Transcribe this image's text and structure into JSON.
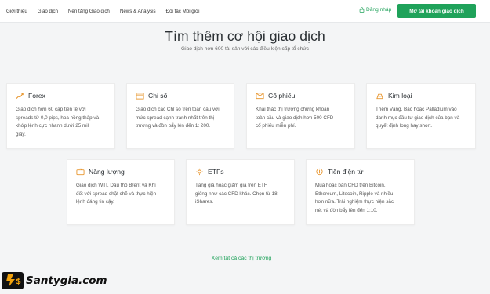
{
  "nav": {
    "items": [
      "Giới thiệu",
      "Giao dịch",
      "Nền tảng Giao dịch",
      "News & Analysis",
      "Đối tác Môi giới"
    ],
    "login_label": "Đăng nhập",
    "open_account_label": "Mở tài khoản giao dịch"
  },
  "hero": {
    "title": "Tìm thêm cơ hội giao dịch",
    "subtitle": "Giao dịch hơn 600 tài sản với các điều kiện cấp tổ chức"
  },
  "cards": [
    {
      "icon": "forex-chart-icon",
      "title": "Forex",
      "desc": [
        "Giao dịch hơn 60 cặp tiền tệ với",
        "spreads từ 0,0 pips, hoa hồng thấp và",
        "khớp lệnh cực nhanh dưới 25 mili",
        "giây."
      ]
    },
    {
      "icon": "indices-calendar-icon",
      "title": "Chỉ số",
      "desc": [
        "Giao dịch các Chỉ số trên toàn cầu với",
        "mức spread cạnh tranh nhất trên thị",
        "trường và đòn bẩy lên đến 1: 200."
      ]
    },
    {
      "icon": "shares-envelope-icon",
      "title": "Cổ phiếu",
      "desc": [
        "Khai thác thị trường chứng khoán",
        "toàn cầu và giao dịch hơn 500 CFD",
        "cổ phiếu miễn phí."
      ]
    },
    {
      "icon": "metals-gold-icon",
      "title": "Kim loại",
      "desc": [
        "Thêm Vàng, Bạc hoặc Palladium vào",
        "danh mục đầu tư giao dịch của bạn và",
        "quyết định long hay short."
      ]
    },
    {
      "icon": "energy-oil-icon",
      "title": "Năng lượng",
      "desc": [
        "Giao dịch WTI, Dầu thô Brent và Khí",
        "đốt với spread chặt chẽ và thực hiện",
        "lệnh đáng tin cậy."
      ]
    },
    {
      "icon": "etfs-sun-icon",
      "title": "ETFs",
      "desc": [
        "Tăng giá hoặc giảm giá trên ETF",
        "giống như các CFD khác. Chọn từ 18",
        "iShares."
      ]
    },
    {
      "icon": "crypto-coin-icon",
      "title": "Tiền điện tử",
      "desc": [
        "Mua hoặc bán CFD trên Bitcoin,",
        "Ethereum, Litecoin, Ripple và nhiều",
        "hơn nữa. Trải nghiệm thực hiện sắc",
        "nét và đòn bẩy lên đến 1:10."
      ]
    }
  ],
  "see_all_label": "Xem tất cả các thị trường",
  "watermark": {
    "text": "Santygia.com"
  },
  "colors": {
    "accent": "#1fa25a",
    "icon_orange": "#e8962e",
    "background": "#f4f5f6"
  }
}
